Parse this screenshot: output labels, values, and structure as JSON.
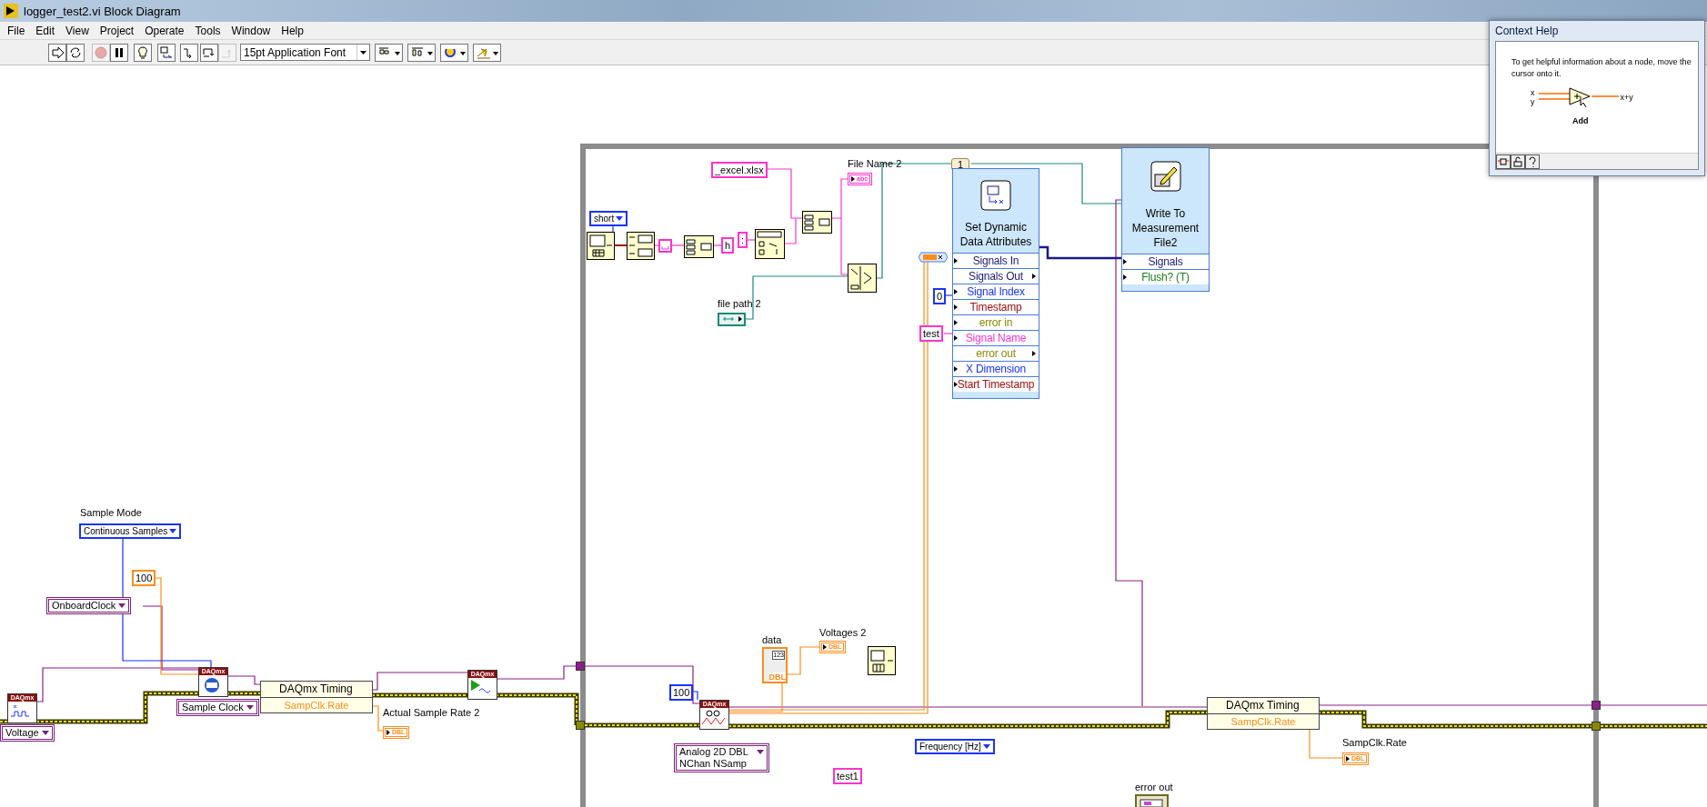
{
  "window": {
    "title": "logger_test2.vi Block Diagram"
  },
  "menu": [
    "File",
    "Edit",
    "View",
    "Project",
    "Operate",
    "Tools",
    "Window",
    "Help"
  ],
  "execution_buttons": [
    {
      "kind": "run",
      "disabled": false
    },
    {
      "kind": "run_continuously",
      "disabled": false
    },
    {
      "kind": "abort",
      "disabled": true
    },
    {
      "kind": "pause",
      "disabled": false
    },
    {
      "kind": "highlight",
      "disabled": false
    },
    {
      "kind": "retain",
      "disabled": false
    },
    {
      "kind": "step_into",
      "disabled": false
    },
    {
      "kind": "step_over",
      "disabled": false
    },
    {
      "kind": "step_out",
      "disabled": true
    }
  ],
  "font_menu": {
    "value": "15pt Application Font"
  },
  "tool_dropdowns": [
    {
      "kind": "align"
    },
    {
      "kind": "distribute"
    },
    {
      "kind": "reorder"
    },
    {
      "kind": "cleanup"
    }
  ],
  "diagram": {
    "nodes": [
      {
        "kind": "label",
        "text": "Sample Mode"
      },
      {
        "kind": "enum",
        "text": "Continuous Samples",
        "color": "#1a33ff"
      },
      {
        "kind": "constant",
        "text": "100",
        "color": "#ff8c1a"
      },
      {
        "kind": "io_enum",
        "text": "OnboardClock",
        "color": "#7a1f7a"
      },
      {
        "kind": "daqmx_create",
        "header": "DAQmx"
      },
      {
        "kind": "io_enum",
        "text": "Voltage",
        "color": "#7a1f7a"
      },
      {
        "kind": "daqmx_clock",
        "header": "DAQmx"
      },
      {
        "kind": "io_enum",
        "text": "Sample Clock",
        "color": "#7a1f7a"
      },
      {
        "kind": "property",
        "title": "DAQmx Timing",
        "row": "SampClk.Rate"
      },
      {
        "kind": "label",
        "text": "Actual Sample Rate 2"
      },
      {
        "kind": "indicator",
        "text": "DBL",
        "color": "#ff8c1a"
      },
      {
        "kind": "daqmx_start",
        "header": "DAQmx"
      },
      {
        "kind": "constant",
        "text": "100",
        "color": "#1a33ff"
      },
      {
        "kind": "daqmx_read",
        "header": "DAQmx"
      },
      {
        "kind": "io_enum",
        "text": "Analog 2D DBL NChan NSamp",
        "color": "#7a1f7a"
      },
      {
        "kind": "label",
        "text": "data"
      },
      {
        "kind": "array_indicator",
        "index": "123",
        "text": "DBL",
        "color": "#ff8c1a"
      },
      {
        "kind": "label",
        "text": "Voltages  2"
      },
      {
        "kind": "indicator",
        "text": "DBL",
        "color": "#ff8c1a"
      },
      {
        "kind": "chart_function"
      },
      {
        "kind": "label",
        "text": "File Name 2"
      },
      {
        "kind": "indicator",
        "text": "abc",
        "color": "#ff33cc"
      },
      {
        "kind": "constant",
        "text": "_excel.xlsx",
        "color": "#ff33cc"
      },
      {
        "kind": "enum",
        "text": "short",
        "color": "#1a33ff"
      },
      {
        "kind": "clock_function"
      },
      {
        "kind": "format_function"
      },
      {
        "kind": "space_constant"
      },
      {
        "kind": "concat_function"
      },
      {
        "kind": "constant",
        "text": "h",
        "color": "#ff33cc"
      },
      {
        "kind": "constant",
        "text": ":",
        "color": "#ff33cc"
      },
      {
        "kind": "search_function"
      },
      {
        "kind": "concat_function"
      },
      {
        "kind": "path_function"
      },
      {
        "kind": "label",
        "text": "file path 2"
      },
      {
        "kind": "path_control"
      },
      {
        "kind": "terminal",
        "text": "1",
        "color": "#9c8a5a"
      },
      {
        "kind": "express",
        "title": "Set Dynamic Data Attributes",
        "rows": [
          {
            "text": "Signals In",
            "color": "#1a1a7a",
            "output": false
          },
          {
            "text": "Signals Out",
            "color": "#1a1a7a",
            "output": true
          },
          {
            "text": "Signal Index",
            "color": "#1a33ff",
            "output": false
          },
          {
            "text": "Timestamp",
            "color": "#a01010",
            "output": false
          },
          {
            "text": "error in",
            "color": "#8a8a00",
            "output": false
          },
          {
            "text": "Signal Name",
            "color": "#ff33cc",
            "output": false
          },
          {
            "text": "error out",
            "color": "#8a8a00",
            "output": true
          },
          {
            "text": "X Dimension",
            "color": "#1a33ff",
            "output": false
          },
          {
            "text": "Start Timestamp",
            "color": "#a01010",
            "output": false
          }
        ]
      },
      {
        "kind": "express",
        "title": "Write To Measurement File2",
        "rows": [
          {
            "text": "Signals",
            "color": "#1a1a7a",
            "output": false
          },
          {
            "text": "Flush? (T)",
            "color": "#1a7a1a",
            "output": false
          }
        ]
      },
      {
        "kind": "type_ring"
      },
      {
        "kind": "constant",
        "text": "0",
        "color": "#1a33ff"
      },
      {
        "kind": "constant",
        "text": "test",
        "color": "#ff33cc"
      },
      {
        "kind": "property",
        "title": "DAQmx Timing",
        "row": "SampClk.Rate"
      },
      {
        "kind": "label",
        "text": "SampClk.Rate"
      },
      {
        "kind": "indicator",
        "text": "DBL",
        "color": "#ff8c1a"
      },
      {
        "kind": "enum",
        "text": "Frequency [Hz]",
        "color": "#1a33ff"
      },
      {
        "kind": "constant",
        "text": "test1",
        "color": "#ff33cc"
      },
      {
        "kind": "label",
        "text": "error out"
      },
      {
        "kind": "cluster_indicator"
      }
    ]
  },
  "context_help": {
    "title": "Context Help",
    "text": "To get helpful information about a node, move the cursor onto it.",
    "inputs": [
      "x",
      "y"
    ],
    "output": "x+y",
    "function_name": "Add"
  }
}
